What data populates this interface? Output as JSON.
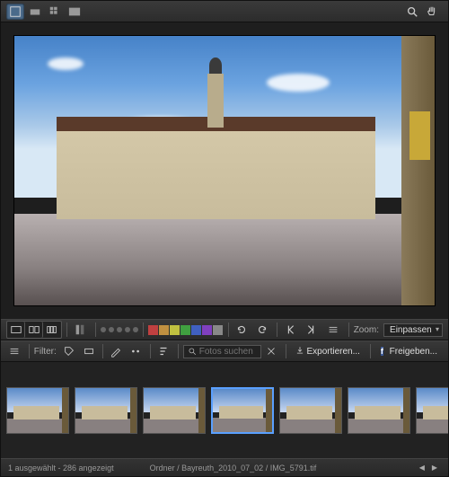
{
  "toolbar1": {
    "zoom_label": "Zoom:",
    "zoom_value": "Einpassen"
  },
  "toolbar2": {
    "filter_label": "Filter:",
    "search_placeholder": "Fotos suchen",
    "export_label": "Exportieren...",
    "share_label": "Freigeben..."
  },
  "color_swatches": [
    "#c04040",
    "#c09040",
    "#c0c040",
    "#40a040",
    "#4060c0",
    "#8040c0",
    "#888888"
  ],
  "status": {
    "selection": "1 ausgewählt - 286 angezeigt",
    "path": "Ordner / Bayreuth_2010_07_02 / IMG_5791.tif"
  },
  "thumbnails": [
    0,
    1,
    2,
    3,
    4,
    5,
    6
  ],
  "selected_thumb": 3
}
